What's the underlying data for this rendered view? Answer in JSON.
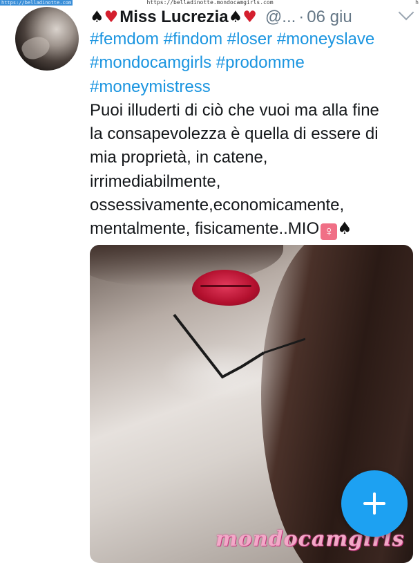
{
  "source_banner": {
    "url_top": "https://belladinotte.mondocamgirls.com",
    "url_side": "https://belladinotte.com",
    "url_corner": "h"
  },
  "tweet": {
    "author": {
      "prefix_emoji": [
        "♠",
        "♥"
      ],
      "name": "Miss Lucrezia",
      "suffix_emoji": [
        "♠",
        "♥"
      ],
      "handle": "@...",
      "separator": "·",
      "date": "06 giu"
    },
    "hashtags": [
      [
        "#femdom",
        "#findom",
        "#loser",
        "#moneyslave"
      ],
      [
        "#mondocamgirls",
        "#prodomme"
      ],
      [
        "#moneymistress"
      ]
    ],
    "text_lines": [
      "Puoi illuderti di ciò che vuoi ma alla fine",
      "la consapevolezza è quella di essere di",
      "mia proprietà, in catene,",
      "irrimediabilmente,",
      "ossessivamente,economicamente,",
      "mentalmente, fisicamente..MIO"
    ],
    "text_end_symbols": [
      "♀",
      "♠"
    ],
    "watermark": "mondocamgirls"
  },
  "colors": {
    "link": "#1b95e0",
    "fab": "#1da1f2",
    "muted": "#657786",
    "heart": "#d41f2e"
  },
  "icons": {
    "overflow": "chevron-down-icon",
    "fab": "plus-icon"
  }
}
